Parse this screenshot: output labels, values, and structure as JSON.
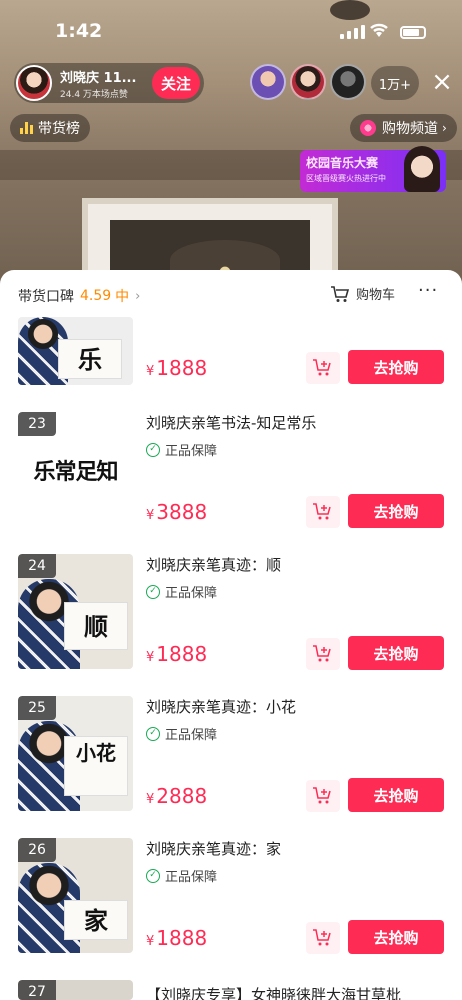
{
  "status_bar": {
    "time": "1:42"
  },
  "host": {
    "name": "刘晓庆 11...",
    "likes": "24.4 万本场点赞",
    "follow_label": "关注"
  },
  "viewer_count": "1万+",
  "close_icon": "×",
  "chips": {
    "rank_label": "带货榜",
    "shop_label": "购物频道"
  },
  "banner": {
    "title": "校园音乐大赛",
    "subtitle": "区域晋级赛火热进行中"
  },
  "sheet": {
    "reputation_label": "带货口碑",
    "reputation_score": "4.59",
    "reputation_level": "中",
    "cart_label": "购物车",
    "more_icon": "···"
  },
  "colors": {
    "accent": "#fe2c55",
    "score": "#ff8a00",
    "guarantee": "#1aaa55"
  },
  "products": [
    {
      "number": "",
      "title": "",
      "guarantee": "",
      "price": "1888",
      "currency": "¥",
      "buy_label": "去抢购",
      "art": "乐"
    },
    {
      "number": "23",
      "title": "刘晓庆亲笔书法-知足常乐",
      "guarantee": "正品保障",
      "price": "3888",
      "currency": "¥",
      "buy_label": "去抢购",
      "art": "乐常足知"
    },
    {
      "number": "24",
      "title": "刘晓庆亲笔真迹：顺",
      "guarantee": "正品保障",
      "price": "1888",
      "currency": "¥",
      "buy_label": "去抢购",
      "art": "顺"
    },
    {
      "number": "25",
      "title": "刘晓庆亲笔真迹：小花",
      "guarantee": "正品保障",
      "price": "2888",
      "currency": "¥",
      "buy_label": "去抢购",
      "art": "小花"
    },
    {
      "number": "26",
      "title": "刘晓庆亲笔真迹：家",
      "guarantee": "正品保障",
      "price": "1888",
      "currency": "¥",
      "buy_label": "去抢购",
      "art": "家"
    },
    {
      "number": "27",
      "title": "【刘晓庆专享】女神晓徕胖大海甘草枇",
      "guarantee": "",
      "price": "",
      "currency": "",
      "buy_label": "",
      "art": ""
    }
  ]
}
